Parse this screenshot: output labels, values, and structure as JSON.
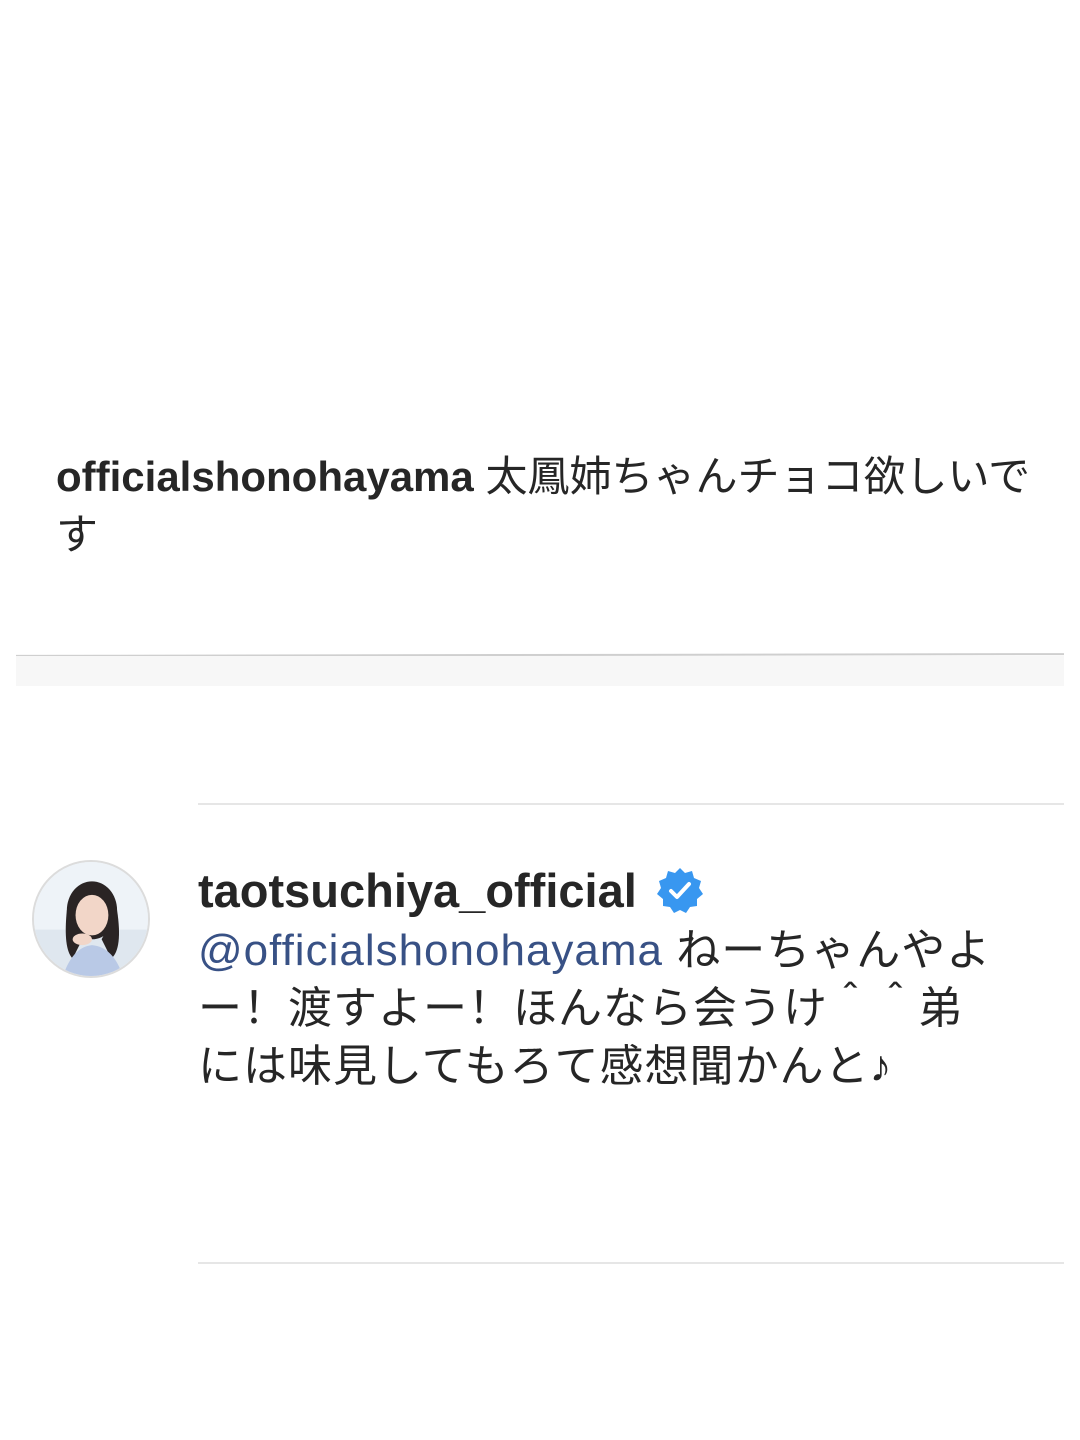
{
  "comment": {
    "username": "officialshonohayama",
    "text": "太鳳姉ちゃんチョコ欲しいです"
  },
  "reply": {
    "username": "taotsuchiya_official",
    "verified_icon": "verified-check-icon",
    "mention": "@officialshonohayama",
    "text": "ねーちゃんやよー！渡すよー！ほんなら会うけ＾＾弟には味見してもろて感想聞かんと♪",
    "avatar_icon": "profile-photo"
  },
  "colors": {
    "mention": "#385185",
    "verified": "#3897f0",
    "text": "#262626"
  }
}
